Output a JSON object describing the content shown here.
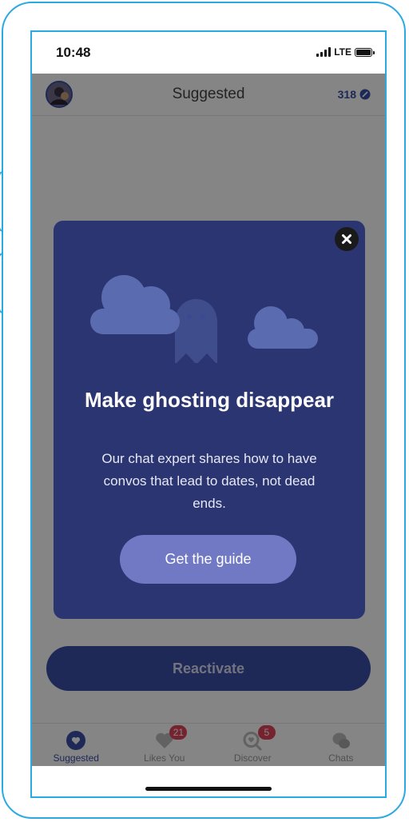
{
  "status_bar": {
    "time": "10:48",
    "network": "LTE"
  },
  "header": {
    "title": "Suggested",
    "credits": "318"
  },
  "reactivate_label": "Reactivate",
  "tabs": [
    {
      "label": "Suggested",
      "badge": "",
      "icon": "heart-circle-icon"
    },
    {
      "label": "Likes You",
      "badge": "21",
      "icon": "heart-icon"
    },
    {
      "label": "Discover",
      "badge": "5",
      "icon": "discover-icon"
    },
    {
      "label": "Chats",
      "badge": "",
      "icon": "chat-bubbles-icon"
    }
  ],
  "modal": {
    "title": "Make ghosting disappear",
    "body": "Our chat expert shares how to have convos that lead to dates, not dead ends.",
    "cta": "Get the guide",
    "illustration": "ghost-and-clouds"
  },
  "colors": {
    "accent": "#3d4fa8",
    "modal_bg": "#2b3571",
    "cta_bg": "#7179c4",
    "badge": "#e2445c",
    "frame": "#29aae2"
  }
}
